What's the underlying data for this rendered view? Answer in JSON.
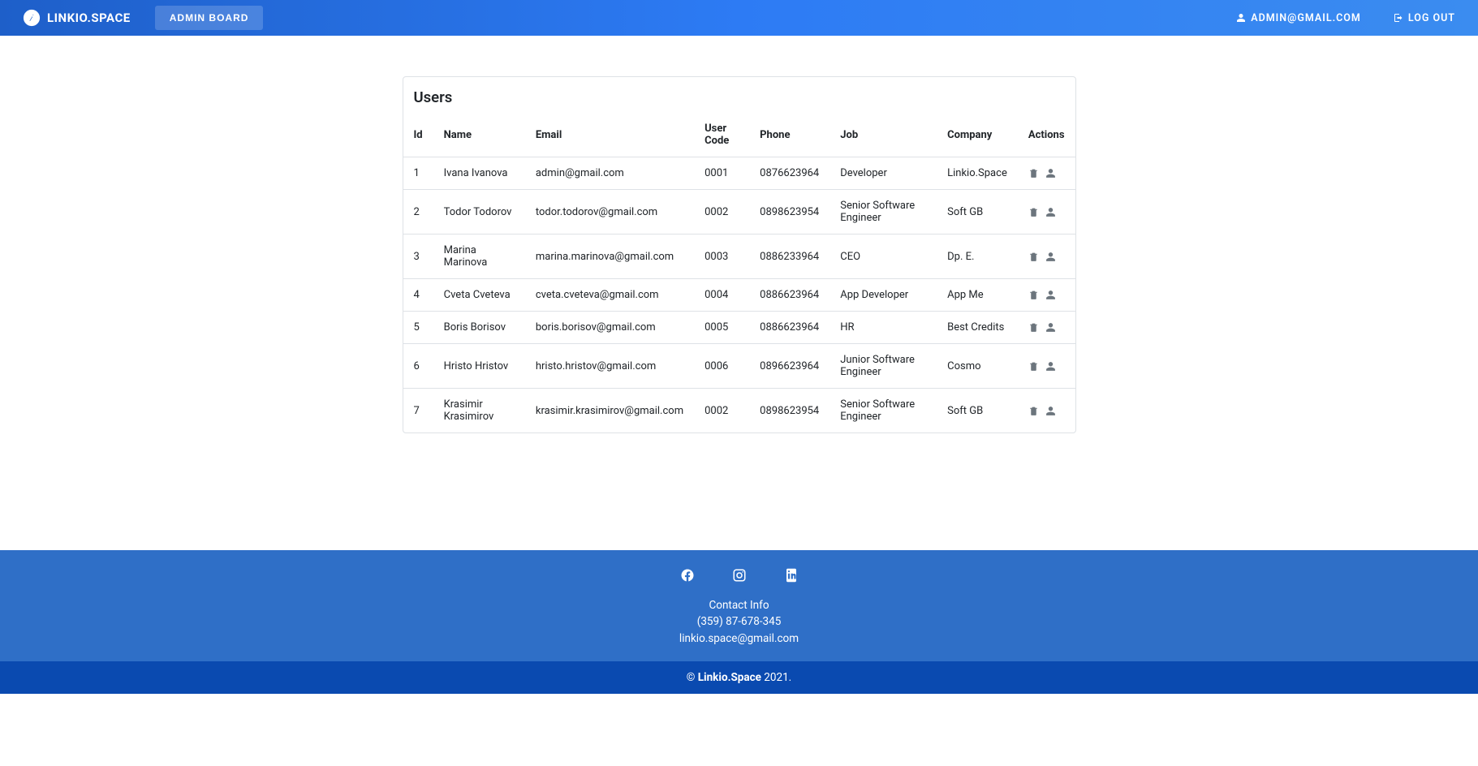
{
  "header": {
    "brand": "LINKIO.SPACE",
    "admin_board": "ADMIN BOARD",
    "user_email": "ADMIN@GMAIL.COM",
    "logout": "LOG OUT"
  },
  "page": {
    "title": "Users"
  },
  "table": {
    "headers": {
      "id": "Id",
      "name": "Name",
      "email": "Email",
      "code": "User Code",
      "phone": "Phone",
      "job": "Job",
      "company": "Company",
      "actions": "Actions"
    },
    "rows": [
      {
        "id": "1",
        "name": "Ivana Ivanova",
        "email": "admin@gmail.com",
        "code": "0001",
        "phone": "0876623964",
        "job": "Developer",
        "company": "Linkio.Space"
      },
      {
        "id": "2",
        "name": "Todor Todorov",
        "email": "todor.todorov@gmail.com",
        "code": "0002",
        "phone": "0898623954",
        "job": "Senior Software Engineer",
        "company": "Soft GB"
      },
      {
        "id": "3",
        "name": "Marina Marinova",
        "email": "marina.marinova@gmail.com",
        "code": "0003",
        "phone": "0886233964",
        "job": "CEO",
        "company": "Dp. E."
      },
      {
        "id": "4",
        "name": "Cveta Cveteva",
        "email": "cveta.cveteva@gmail.com",
        "code": "0004",
        "phone": "0886623964",
        "job": "App Developer",
        "company": "App Me"
      },
      {
        "id": "5",
        "name": "Boris Borisov",
        "email": "boris.borisov@gmail.com",
        "code": "0005",
        "phone": "0886623964",
        "job": "HR",
        "company": "Best Credits"
      },
      {
        "id": "6",
        "name": "Hristo Hristov",
        "email": "hristo.hristov@gmail.com",
        "code": "0006",
        "phone": "0896623964",
        "job": "Junior Software Engineer",
        "company": "Cosmo"
      },
      {
        "id": "7",
        "name": "Krasimir Krasimirov",
        "email": "krasimir.krasimirov@gmail.com",
        "code": "0002",
        "phone": "0898623954",
        "job": "Senior Software Engineer",
        "company": "Soft GB"
      }
    ]
  },
  "footer": {
    "contact_label": "Contact Info",
    "phone": "(359) 87-678-345",
    "email": "linkio.space@gmail.com",
    "copyright_prefix": "© ",
    "copyright_brand": "Linkio.Space",
    "copyright_suffix": " 2021."
  }
}
